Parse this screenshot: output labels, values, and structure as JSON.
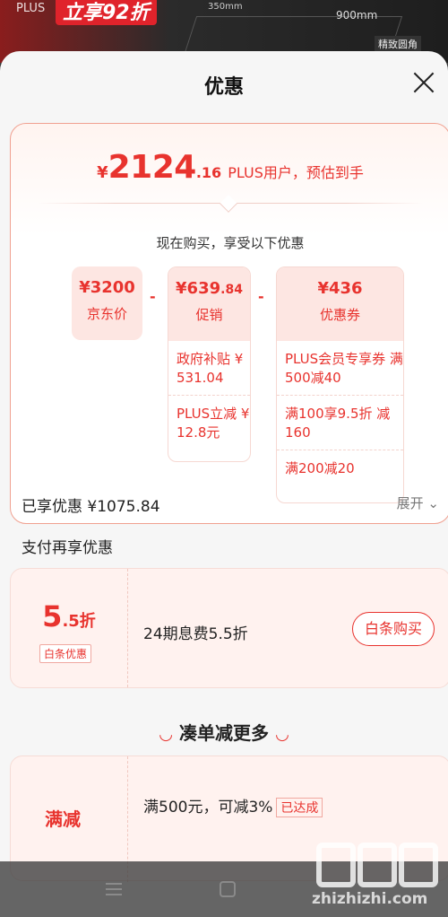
{
  "background": {
    "plus_label": "PLUS",
    "promo_text": "立享92折",
    "dimension_1": "350mm",
    "dimension_2": "900mm",
    "tag": "精致圆角"
  },
  "sheet": {
    "title": "优惠"
  },
  "final_price": {
    "symbol": "¥",
    "integer": "2124",
    "decimal": ".16",
    "note": "PLUS用户，预估到手"
  },
  "breakdown": {
    "subtitle": "现在购买，享受以下优惠",
    "minus_sign": "-",
    "jd_price": {
      "amount": "¥3200",
      "label": "京东价"
    },
    "promotion": {
      "amount_main": "¥639",
      "amount_dec": ".84",
      "label": "促销",
      "items": [
        "政府补贴 ¥ 531.04",
        "PLUS立减 ¥ 12.8元"
      ]
    },
    "coupon": {
      "amount": "¥436",
      "label": "优惠券",
      "items": [
        "PLUS会员专享券 满500减40",
        "满100享9.5折 减160",
        "满200减20"
      ]
    }
  },
  "saved": {
    "text": "已享优惠 ¥1075.84",
    "expand_label": "展开"
  },
  "payment": {
    "section_title": "支付再享优惠",
    "rate_big": "5",
    "rate_small": ".5折",
    "tag": "白条优惠",
    "description": "24期息费5.5折",
    "button_label": "白条购买"
  },
  "more": {
    "title": "凑单减更多",
    "left_label": "满减",
    "description": "满500元，可减3%",
    "tag": "已达成"
  },
  "watermark": {
    "text": "zhizhizhi.com"
  },
  "colors": {
    "accent": "#e8332e",
    "light_accent": "#fde6e2"
  }
}
